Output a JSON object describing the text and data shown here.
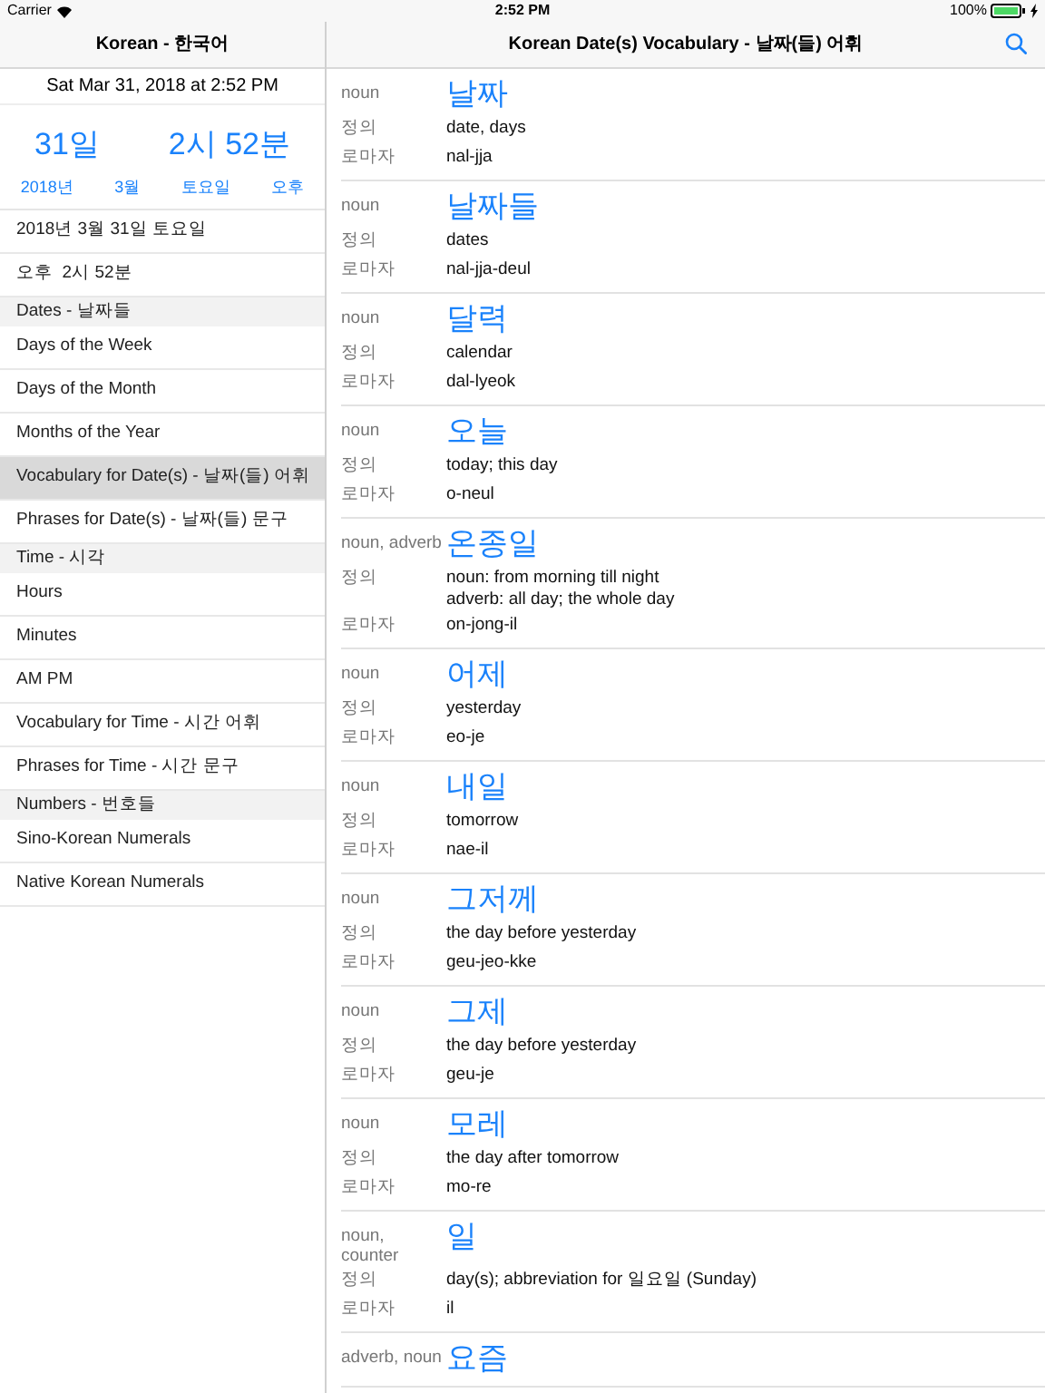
{
  "status_bar": {
    "carrier": "Carrier",
    "time": "2:52 PM",
    "battery": "100%"
  },
  "sidebar": {
    "title": "Korean - 한국어",
    "datetime": "Sat Mar 31, 2018 at 2:52 PM",
    "big": [
      "31일",
      "2시 52분"
    ],
    "small": [
      "2018년",
      "3월",
      "토요일",
      "오후"
    ],
    "items": [
      {
        "kind": "row",
        "label": "2018년 3월 31일 토요일",
        "selected": false
      },
      {
        "kind": "row",
        "label": "오후  2시 52분",
        "selected": false
      },
      {
        "kind": "header",
        "label": "Dates - 날짜들"
      },
      {
        "kind": "row",
        "label": "Days of the Week",
        "selected": false
      },
      {
        "kind": "row",
        "label": "Days of the Month",
        "selected": false
      },
      {
        "kind": "row",
        "label": "Months of the Year",
        "selected": false
      },
      {
        "kind": "row",
        "label": "Vocabulary for Date(s) - 날짜(들) 어휘",
        "selected": true
      },
      {
        "kind": "row",
        "label": "Phrases for Date(s) - 날짜(들) 문구",
        "selected": false
      },
      {
        "kind": "header",
        "label": "Time - 시각"
      },
      {
        "kind": "row",
        "label": "Hours",
        "selected": false
      },
      {
        "kind": "row",
        "label": "Minutes",
        "selected": false
      },
      {
        "kind": "row",
        "label": "AM PM",
        "selected": false
      },
      {
        "kind": "row",
        "label": "Vocabulary for Time - 시간 어휘",
        "selected": false
      },
      {
        "kind": "row",
        "label": "Phrases for Time - 시간 문구",
        "selected": false
      },
      {
        "kind": "header",
        "label": "Numbers - 번호들"
      },
      {
        "kind": "row",
        "label": "Sino-Korean Numerals",
        "selected": false
      },
      {
        "kind": "row",
        "label": "Native Korean Numerals",
        "selected": false
      }
    ]
  },
  "detail": {
    "title": "Korean Date(s) Vocabulary - 날짜(들) 어휘",
    "entries": [
      {
        "pos": "noun",
        "word": "날짜",
        "definition": [
          "date, days"
        ],
        "romanization": "nal-jja",
        "definition_label": "정의",
        "romanization_label": "로마자"
      },
      {
        "pos": "noun",
        "word": "날짜들",
        "definition": [
          "dates"
        ],
        "romanization": "nal-jja-deul",
        "definition_label": "정의",
        "romanization_label": "로마자"
      },
      {
        "pos": "noun",
        "word": "달력",
        "definition": [
          "calendar"
        ],
        "romanization": "dal-lyeok",
        "definition_label": "정의",
        "romanization_label": "로마자"
      },
      {
        "pos": "noun",
        "word": "오늘",
        "definition": [
          "today; this day"
        ],
        "romanization": "o-neul",
        "definition_label": "정의",
        "romanization_label": "로마자"
      },
      {
        "pos": "noun, adverb",
        "word": "온종일",
        "definition": [
          "noun: from morning till night",
          "adverb: all day; the whole day"
        ],
        "romanization": "on-jong-il",
        "definition_label": "정의",
        "romanization_label": "로마자"
      },
      {
        "pos": "noun",
        "word": "어제",
        "definition": [
          "yesterday"
        ],
        "romanization": "eo-je",
        "definition_label": "정의",
        "romanization_label": "로마자"
      },
      {
        "pos": "noun",
        "word": "내일",
        "definition": [
          "tomorrow"
        ],
        "romanization": "nae-il",
        "definition_label": "정의",
        "romanization_label": "로마자"
      },
      {
        "pos": "noun",
        "word": "그저께",
        "definition": [
          "the day before yesterday"
        ],
        "romanization": "geu-jeo-kke",
        "definition_label": "정의",
        "romanization_label": "로마자"
      },
      {
        "pos": "noun",
        "word": "그제",
        "definition": [
          "the day before yesterday"
        ],
        "romanization": "geu-je",
        "definition_label": "정의",
        "romanization_label": "로마자"
      },
      {
        "pos": "noun",
        "word": "모레",
        "definition": [
          "the day after tomorrow"
        ],
        "romanization": "mo-re",
        "definition_label": "정의",
        "romanization_label": "로마자"
      },
      {
        "pos": "noun, counter",
        "word": "일",
        "definition": [
          "day(s); abbreviation for 일요일 (Sunday)"
        ],
        "romanization": "il",
        "definition_label": "정의",
        "romanization_label": "로마자"
      },
      {
        "pos": "adverb, noun",
        "word": "요즘"
      }
    ]
  }
}
